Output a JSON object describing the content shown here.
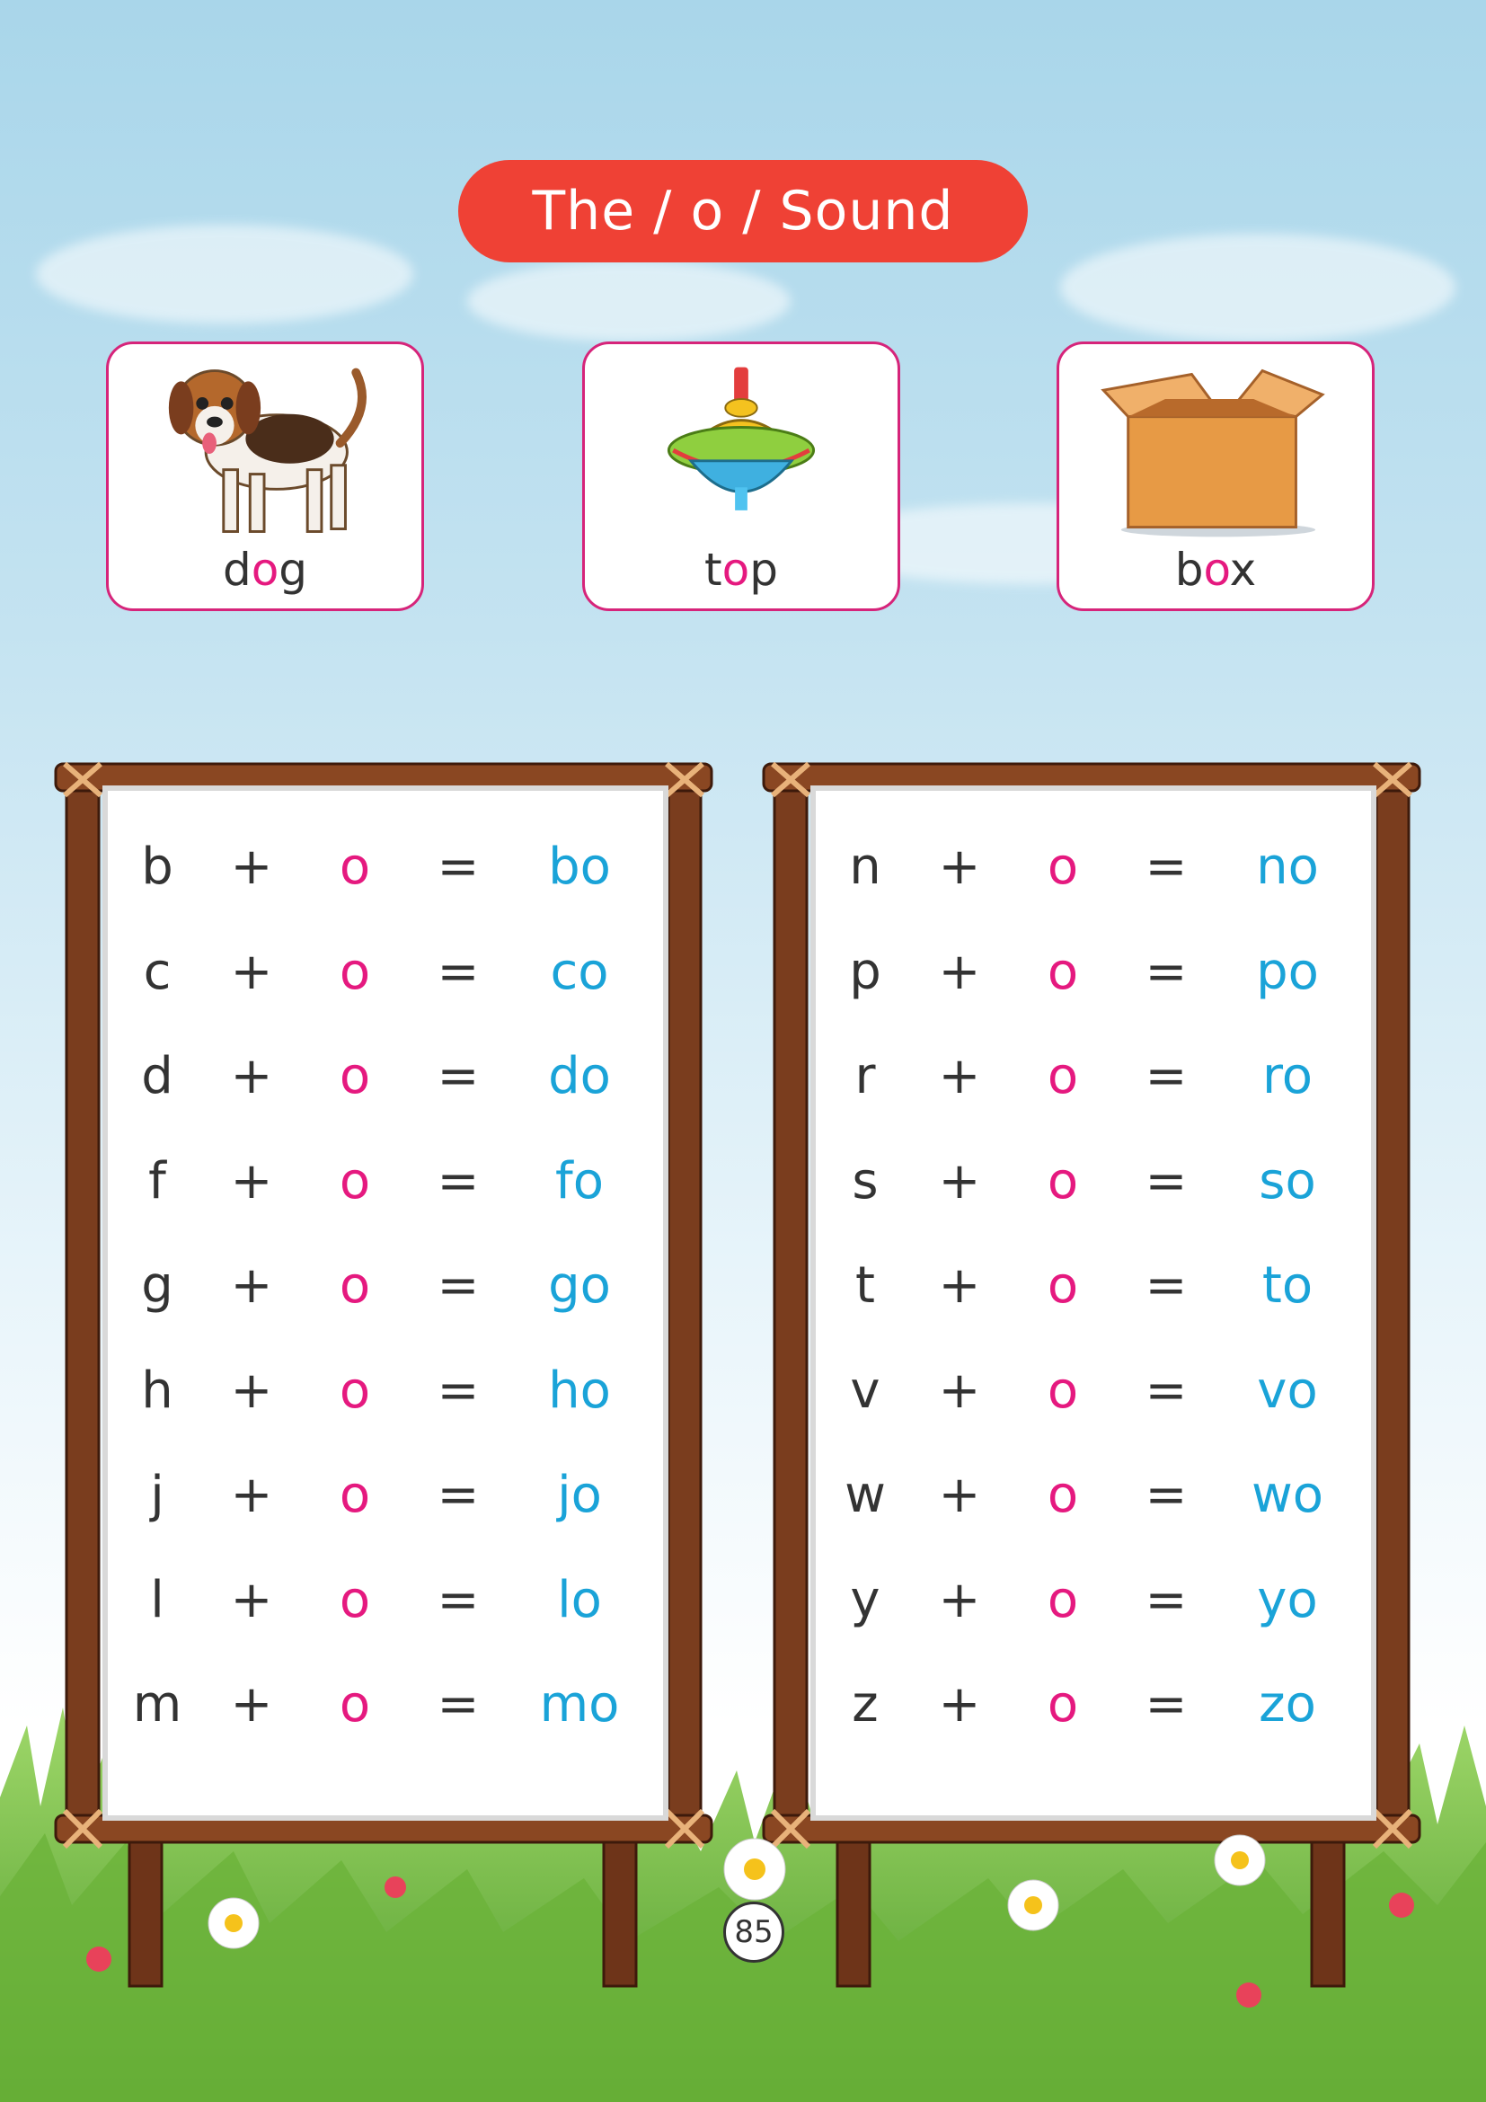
{
  "title": {
    "before": "The / ",
    "vowel": "o",
    "after": " / Sound"
  },
  "cards": [
    {
      "word_start": "d",
      "word_vowel": "o",
      "word_end": "g",
      "icon": "dog-icon"
    },
    {
      "word_start": "t",
      "word_vowel": "o",
      "word_end": "p",
      "icon": "spinning-top-icon"
    },
    {
      "word_start": "b",
      "word_vowel": "o",
      "word_end": "x",
      "icon": "box-icon"
    }
  ],
  "boards": [
    {
      "rows": [
        {
          "letter": "b",
          "plus": "+",
          "vowel": "o",
          "equals": "=",
          "result": "bo"
        },
        {
          "letter": "c",
          "plus": "+",
          "vowel": "o",
          "equals": "=",
          "result": "co"
        },
        {
          "letter": "d",
          "plus": "+",
          "vowel": "o",
          "equals": "=",
          "result": "do"
        },
        {
          "letter": "f",
          "plus": "+",
          "vowel": "o",
          "equals": "=",
          "result": "fo"
        },
        {
          "letter": "g",
          "plus": "+",
          "vowel": "o",
          "equals": "=",
          "result": "go"
        },
        {
          "letter": "h",
          "plus": "+",
          "vowel": "o",
          "equals": "=",
          "result": "ho"
        },
        {
          "letter": "j",
          "plus": "+",
          "vowel": "o",
          "equals": "=",
          "result": "jo"
        },
        {
          "letter": "l",
          "plus": "+",
          "vowel": "o",
          "equals": "=",
          "result": "lo"
        },
        {
          "letter": "m",
          "plus": "+",
          "vowel": "o",
          "equals": "=",
          "result": "mo"
        }
      ]
    },
    {
      "rows": [
        {
          "letter": "n",
          "plus": "+",
          "vowel": "o",
          "equals": "=",
          "result": "no"
        },
        {
          "letter": "p",
          "plus": "+",
          "vowel": "o",
          "equals": "=",
          "result": "po"
        },
        {
          "letter": "r",
          "plus": "+",
          "vowel": "o",
          "equals": "=",
          "result": "ro"
        },
        {
          "letter": "s",
          "plus": "+",
          "vowel": "o",
          "equals": "=",
          "result": "so"
        },
        {
          "letter": "t",
          "plus": "+",
          "vowel": "o",
          "equals": "=",
          "result": "to"
        },
        {
          "letter": "v",
          "plus": "+",
          "vowel": "o",
          "equals": "=",
          "result": "vo"
        },
        {
          "letter": "w",
          "plus": "+",
          "vowel": "o",
          "equals": "=",
          "result": "wo"
        },
        {
          "letter": "y",
          "plus": "+",
          "vowel": "o",
          "equals": "=",
          "result": "yo"
        },
        {
          "letter": "z",
          "plus": "+",
          "vowel": "o",
          "equals": "=",
          "result": "zo"
        }
      ]
    }
  ],
  "page_number": "85",
  "colors": {
    "title_bg": "#ef4135",
    "vowel": "#e5197f",
    "result": "#1aa3d8",
    "card_border": "#d6247a",
    "wood": "#7a3d1e"
  }
}
